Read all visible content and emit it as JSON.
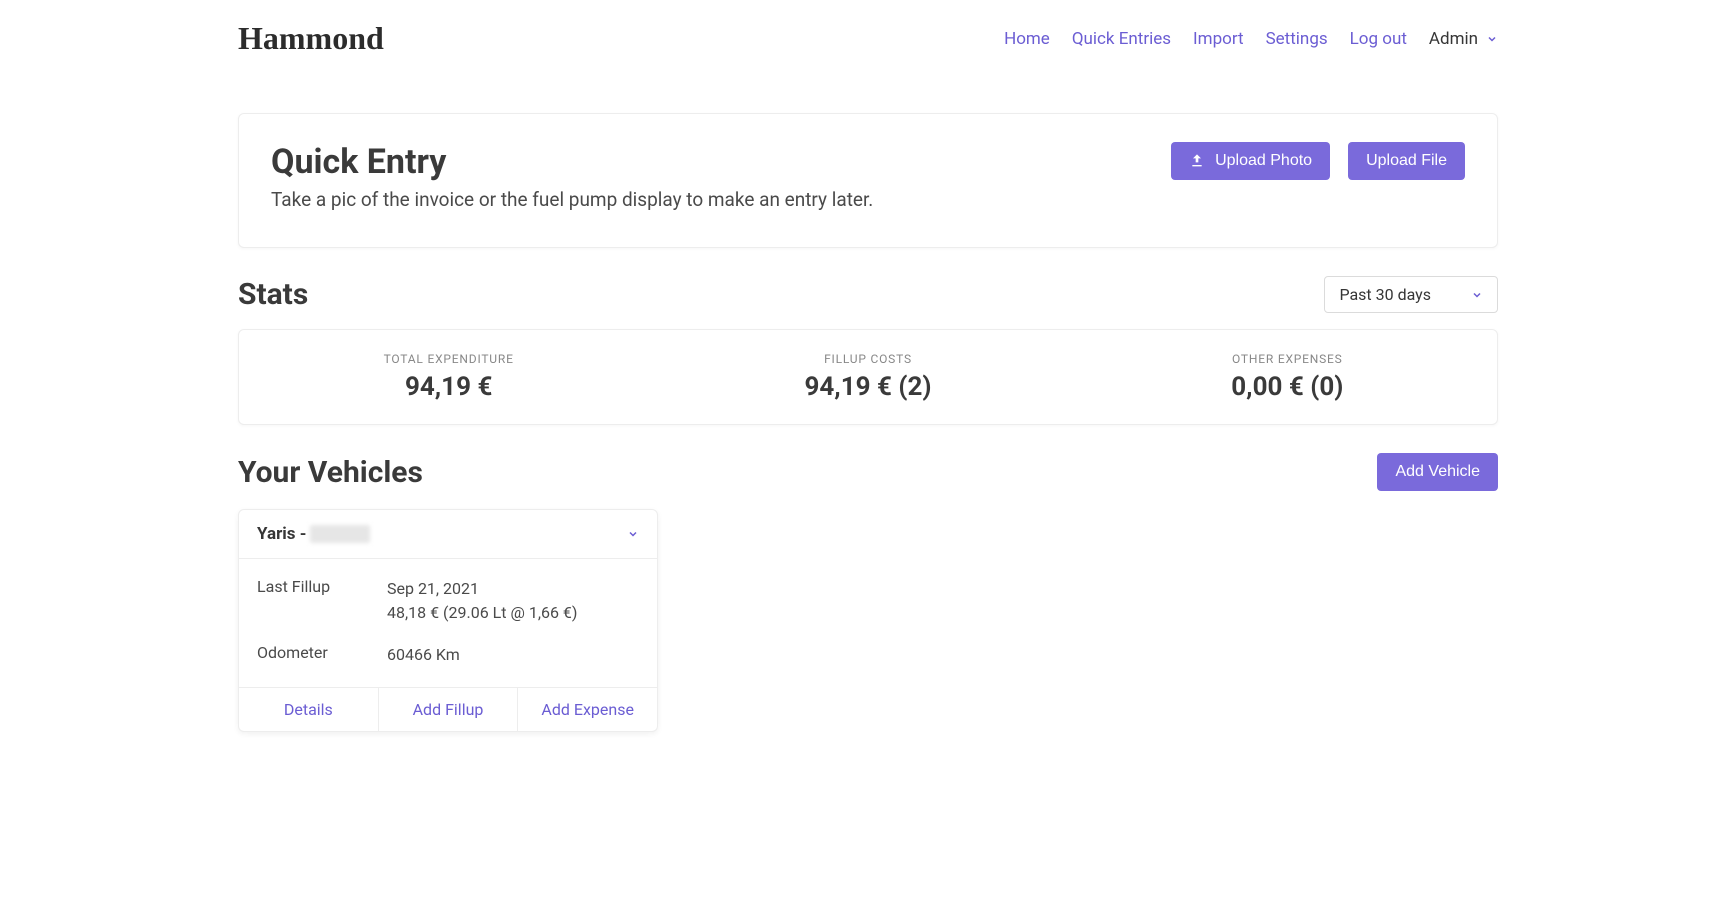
{
  "brand": "Hammond",
  "nav": {
    "home": "Home",
    "quick_entries": "Quick Entries",
    "import": "Import",
    "settings": "Settings",
    "logout": "Log out",
    "user": "Admin"
  },
  "quick_entry": {
    "title": "Quick Entry",
    "subtitle": "Take a pic of the invoice or the fuel pump display to make an entry later.",
    "upload_photo": "Upload Photo",
    "upload_file": "Upload File"
  },
  "stats": {
    "title": "Stats",
    "range_selected": "Past 30 days",
    "items": [
      {
        "label": "TOTAL EXPENDITURE",
        "value": "94,19 €"
      },
      {
        "label": "FILLUP COSTS",
        "value": "94,19 € (2)"
      },
      {
        "label": "OTHER EXPENSES",
        "value": "0,00 € (0)"
      }
    ]
  },
  "vehicles": {
    "title": "Your Vehicles",
    "add_button": "Add Vehicle",
    "list": [
      {
        "name": "Yaris - ",
        "last_fillup_label": "Last Fillup",
        "last_fillup_date": "Sep 21, 2021",
        "last_fillup_detail": "48,18 € (29.06 Lt @ 1,66 €)",
        "odometer_label": "Odometer",
        "odometer_value": "60466 Km",
        "actions": {
          "details": "Details",
          "add_fillup": "Add Fillup",
          "add_expense": "Add Expense"
        }
      }
    ]
  }
}
